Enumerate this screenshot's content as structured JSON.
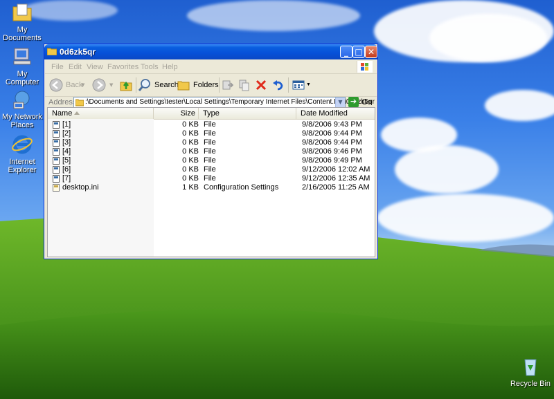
{
  "desktop": {
    "icons": [
      {
        "label": "My Documents",
        "icon": "my-documents-icon"
      },
      {
        "label": "My Computer",
        "icon": "my-computer-icon"
      },
      {
        "label": "My Network Places",
        "icon": "network-places-icon"
      },
      {
        "label": "Internet Explorer",
        "icon": "internet-explorer-icon"
      },
      {
        "label": "Recycle Bin",
        "icon": "recycle-bin-icon"
      }
    ]
  },
  "window": {
    "title": "0d6zk5qr",
    "controls": {
      "minimize": "_",
      "maximize": "□",
      "close": "✕"
    },
    "menu": [
      "File",
      "Edit",
      "View",
      "Favorites",
      "Tools",
      "Help"
    ],
    "toolbar": {
      "back_label": "Back",
      "search_label": "Search",
      "folders_label": "Folders"
    },
    "address": {
      "label": "Address",
      "path": ":\\Documents and Settings\\tester\\Local Settings\\Temporary Internet Files\\Content.IE5\\0d6zk5qr",
      "go_label": "Go"
    },
    "columns": {
      "name": "Name",
      "size": "Size",
      "type": "Type",
      "date": "Date Modified"
    },
    "files": [
      {
        "name": "[1]",
        "size": "0 KB",
        "type": "File",
        "date": "9/8/2006 9:43 PM"
      },
      {
        "name": "[2]",
        "size": "0 KB",
        "type": "File",
        "date": "9/8/2006 9:44 PM"
      },
      {
        "name": "[3]",
        "size": "0 KB",
        "type": "File",
        "date": "9/8/2006 9:44 PM"
      },
      {
        "name": "[4]",
        "size": "0 KB",
        "type": "File",
        "date": "9/8/2006 9:46 PM"
      },
      {
        "name": "[5]",
        "size": "0 KB",
        "type": "File",
        "date": "9/8/2006 9:49 PM"
      },
      {
        "name": "[6]",
        "size": "0 KB",
        "type": "File",
        "date": "9/12/2006 12:02 AM"
      },
      {
        "name": "[7]",
        "size": "0 KB",
        "type": "File",
        "date": "9/12/2006 12:35 AM"
      },
      {
        "name": "desktop.ini",
        "size": "1 KB",
        "type": "Configuration Settings",
        "date": "2/16/2005 11:25 AM"
      }
    ]
  },
  "colors": {
    "titlebar": "#0a5fe0",
    "window_bg": "#ece9d8",
    "sky": "#3a80e8",
    "grass": "#4f9a1e"
  }
}
